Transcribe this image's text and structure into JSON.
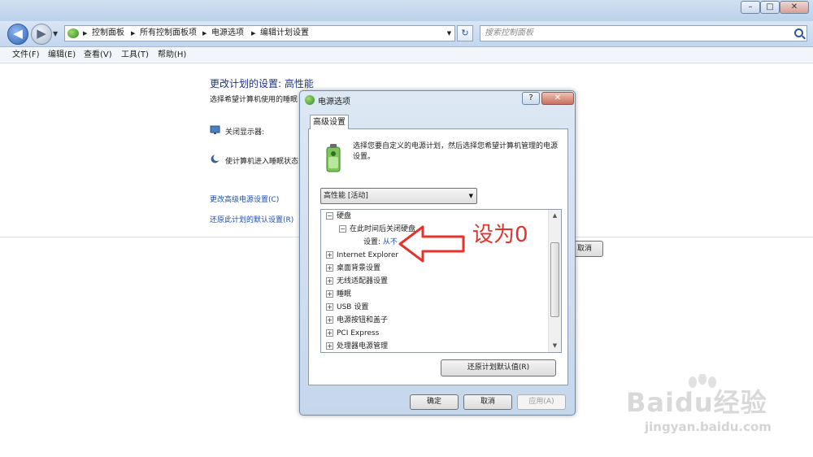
{
  "window": {
    "minimize": "–",
    "maximize": "□",
    "close": "✕"
  },
  "nav": {
    "back": "◀",
    "forward": "▶",
    "history": "▼",
    "breadcrumbs": [
      "控制面板",
      "所有控制面板项",
      "电源选项",
      "编辑计划设置"
    ],
    "search_placeholder": "搜索控制面板",
    "refresh": "↻"
  },
  "menu": [
    "文件(F)",
    "编辑(E)",
    "查看(V)",
    "工具(T)",
    "帮助(H)"
  ],
  "main": {
    "title": "更改计划的设置: 高性能",
    "description": "选择希望计算机使用的睡眠",
    "display_off_label": "关闭显示器:",
    "sleep_label": "使计算机进入睡眠状态",
    "advanced_link": "更改高级电源设置(C)",
    "restore_link": "还原此计划的默认设置(R)",
    "cancel_partial": "取消"
  },
  "dialog": {
    "title": "电源选项",
    "help": "?",
    "close": "✕",
    "tab": "高级设置",
    "description": "选择您要自定义的电源计划，然后选择您希望计算机管理的电源设置。",
    "plan_select": "高性能 [活动]",
    "tree": [
      {
        "label": "硬盘",
        "toggle": "−",
        "level": 0
      },
      {
        "label": "在此时间后关闭硬盘",
        "toggle": "−",
        "level": 1
      },
      {
        "label": "设置:",
        "value": "从不",
        "level": 2
      },
      {
        "label": "Internet Explorer",
        "toggle": "+",
        "level": 0
      },
      {
        "label": "桌面背景设置",
        "toggle": "+",
        "level": 0
      },
      {
        "label": "无线适配器设置",
        "toggle": "+",
        "level": 0
      },
      {
        "label": "睡眠",
        "toggle": "+",
        "level": 0
      },
      {
        "label": "USB 设置",
        "toggle": "+",
        "level": 0
      },
      {
        "label": "电源按钮和盖子",
        "toggle": "+",
        "level": 0
      },
      {
        "label": "PCI Express",
        "toggle": "+",
        "level": 0
      },
      {
        "label": "处理器电源管理",
        "toggle": "+",
        "level": 0
      }
    ],
    "restore_button": "还原计划默认值(R)",
    "ok": "确定",
    "cancel": "取消",
    "apply": "应用(A)"
  },
  "annotation": {
    "text": "设为0",
    "color": "#e5322b"
  },
  "watermark": {
    "brand": "Baidu经验",
    "url": "jingyan.baidu.com"
  }
}
